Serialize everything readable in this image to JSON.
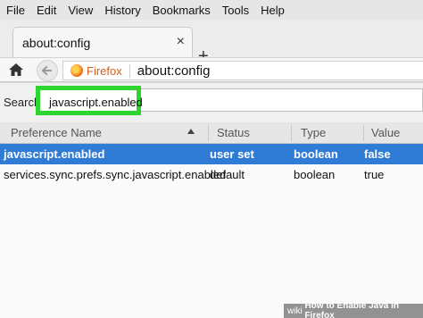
{
  "menu": [
    "File",
    "Edit",
    "View",
    "History",
    "Bookmarks",
    "Tools",
    "Help"
  ],
  "tab": {
    "title": "about:config",
    "close": "×"
  },
  "newtab": "+",
  "nav": {
    "identity_label": "Firefox",
    "url": "about:config"
  },
  "search": {
    "label": "Search:",
    "value": "javascript.enabled"
  },
  "table": {
    "headers": [
      "Preference Name",
      "Status",
      "Type",
      "Value"
    ],
    "rows": [
      {
        "name": "javascript.enabled",
        "status": "user set",
        "type": "boolean",
        "value": "false",
        "selected": true
      },
      {
        "name": "services.sync.prefs.sync.javascript.enabled",
        "status": "default",
        "type": "boolean",
        "value": "true",
        "selected": false
      }
    ]
  },
  "watermark": {
    "brand": "wiki",
    "text": "How to Enable Java in Firefox"
  },
  "colors": {
    "highlight": "#2fd52f",
    "selected_row": "#2f7bd6",
    "firefox_orange": "#d45d1b"
  },
  "icons": [
    "home-icon",
    "back-arrow-icon",
    "firefox-icon",
    "close-icon",
    "plus-icon",
    "sort-up-icon"
  ]
}
